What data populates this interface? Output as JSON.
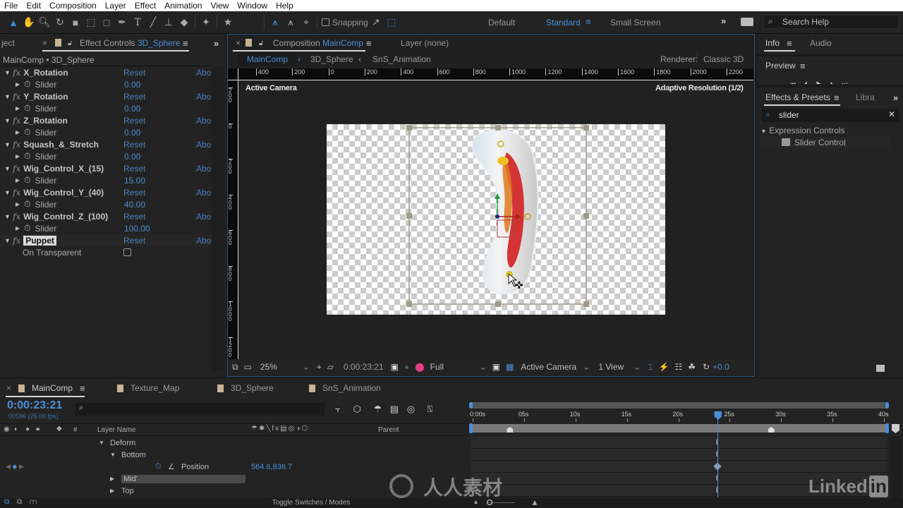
{
  "menu": [
    "File",
    "Edit",
    "Composition",
    "Layer",
    "Effect",
    "Animation",
    "View",
    "Window",
    "Help"
  ],
  "toolbar": {
    "snapping_label": "Snapping",
    "workspaces": [
      {
        "label": "Default",
        "active": false
      },
      {
        "label": "Standard",
        "active": true
      },
      {
        "label": "Small Screen",
        "active": false
      }
    ],
    "search_help_placeholder": "Search Help"
  },
  "project_tab": "ject",
  "effect_controls": {
    "tab_prefix": "Effect Controls",
    "tab_layer": "3D_Sphere",
    "breadcrumb": "MainComp • 3D_Sphere",
    "reset_label": "Reset",
    "about_label": "Abo",
    "effects": [
      {
        "name": "X_Rotation",
        "param": "Slider",
        "value": "0.00"
      },
      {
        "name": "Y_Rotation",
        "param": "Slider",
        "value": "0.00"
      },
      {
        "name": "Z_Rotation",
        "param": "Slider",
        "value": "0.00"
      },
      {
        "name": "Squash_&_Stretch",
        "param": "Slider",
        "value": "0.00"
      },
      {
        "name": "Wig_Control_X_(15)",
        "param": "Slider",
        "value": "15.00"
      },
      {
        "name": "Wig_Control_Y_(40)",
        "param": "Slider",
        "value": "40.00"
      },
      {
        "name": "Wig_Control_Z_(100)",
        "param": "Slider",
        "value": "100.00"
      }
    ],
    "puppet": {
      "name": "Puppet",
      "option": "On Transparent",
      "checked": false
    }
  },
  "composition": {
    "tab_prefix": "Composition",
    "tab_name": "MainComp",
    "layer_tab": "Layer (none)",
    "flow": [
      "MainComp",
      "3D_Sphere",
      "SnS_Animation"
    ],
    "renderer_label": "Renderer:",
    "renderer_value": "Classic 3D",
    "camera_label": "Active Camera",
    "resolution_label": "Adaptive Resolution (1/2)",
    "ruler_h": [
      "400",
      "200",
      "0",
      "200",
      "400",
      "600",
      "800",
      "1000",
      "1200",
      "1400",
      "1600",
      "1800",
      "2000",
      "2200"
    ],
    "ruler_v": [
      "200",
      "0",
      "200",
      "400",
      "600",
      "800",
      "1000",
      "1200"
    ],
    "viewer": {
      "zoom": "25%",
      "timecode": "0:00:23:21",
      "quality": "Full",
      "camera": "Active Camera",
      "views": "1 View",
      "exposure": "+0.0"
    }
  },
  "right_panels": {
    "info_tab": "Info",
    "audio_tab": "Audio",
    "preview_tab": "Preview",
    "effects_tab": "Effects & Presets",
    "libraries_tab": "Libra",
    "search_value": "slider",
    "category": "Expression Controls",
    "item": "Slider Control"
  },
  "timeline": {
    "tabs": [
      {
        "label": "MainComp",
        "active": true
      },
      {
        "label": "Texture_Map",
        "active": false
      },
      {
        "label": "3D_Sphere",
        "active": false
      },
      {
        "label": "SnS_Animation",
        "active": false
      }
    ],
    "timecode": "0:00:23:21",
    "frame_info": "00596 (25.00 fps)",
    "columns": {
      "hash": "#",
      "layer_name": "Layer Name",
      "parent": "Parent"
    },
    "time_ticks": [
      "0:00s",
      "05s",
      "10s",
      "15s",
      "20s",
      "25s",
      "30s",
      "35s",
      "40s"
    ],
    "duration_s": 40,
    "current_time_s": 23.84,
    "work_markers_s": [
      3.6,
      29
    ],
    "rows": [
      {
        "label": "Deform",
        "indent": 1,
        "expanded": true
      },
      {
        "label": "Bottom",
        "indent": 2,
        "expanded": true
      },
      {
        "label": "Position",
        "indent": 3,
        "value": "564.6,836.7",
        "property": true
      },
      {
        "label": "Mid'",
        "indent": 2,
        "expanded": false,
        "selected": true
      },
      {
        "label": "Top",
        "indent": 2,
        "expanded": false
      }
    ],
    "toggle_label": "Toggle Switches / Modes"
  },
  "watermark": {
    "brand": "人人素材",
    "linkedin": "Linked"
  }
}
